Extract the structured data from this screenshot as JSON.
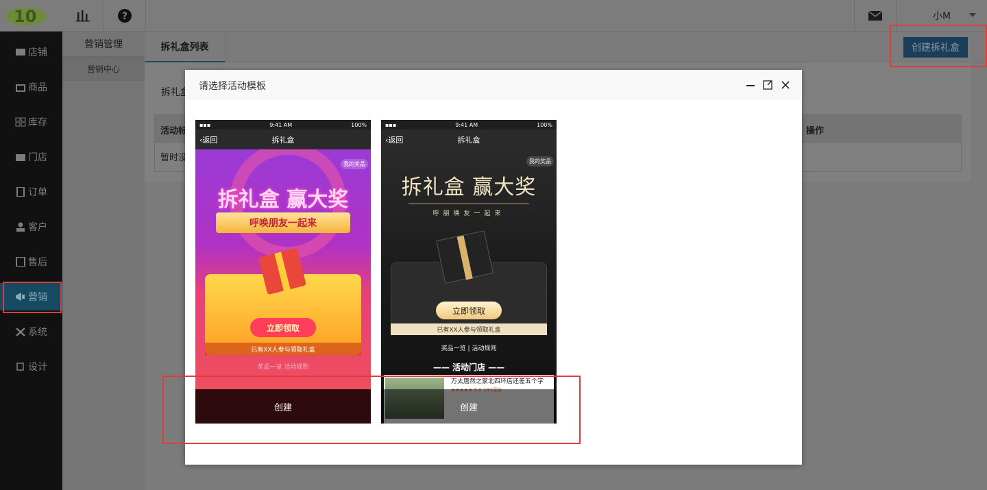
{
  "topbar": {
    "logo_text": "10",
    "user_name": "小M"
  },
  "sidebar": {
    "items": [
      {
        "label": "店铺",
        "icon": "store-icon"
      },
      {
        "label": "商品",
        "icon": "product-icon"
      },
      {
        "label": "库存",
        "icon": "inventory-icon"
      },
      {
        "label": "门店",
        "icon": "shop-icon"
      },
      {
        "label": "订单",
        "icon": "order-icon"
      },
      {
        "label": "客户",
        "icon": "customer-icon"
      },
      {
        "label": "售后",
        "icon": "aftersale-icon"
      },
      {
        "label": "营销",
        "icon": "megaphone-icon",
        "active": true
      },
      {
        "label": "系统",
        "icon": "tools-icon"
      },
      {
        "label": "设计",
        "icon": "design-icon"
      }
    ]
  },
  "subnav": {
    "title": "营销管理",
    "items": [
      "营销中心"
    ]
  },
  "main": {
    "tab": "拆礼盒列表",
    "create_button": "创建拆礼盒",
    "panel_label": "拆礼盒",
    "table": {
      "col1": "活动标",
      "col_ops": "操作",
      "empty_text": "暂时没"
    }
  },
  "modal": {
    "title": "请选择活动模板",
    "templates": [
      {
        "status_time": "9:41 AM",
        "status_battery": "100%",
        "back": "返回",
        "nav_title": "拆礼盒",
        "badge": "我的奖品",
        "headline": "拆礼盒 赢大奖",
        "ribbon": "呼唤朋友一起来",
        "button": "立即领取",
        "join_text": "已有XX人参与领取礼盒",
        "links": "奖品一览  活动规则",
        "create": "创建"
      },
      {
        "status_time": "9:41 AM",
        "status_battery": "100%",
        "back": "返回",
        "nav_title": "拆礼盒",
        "badge": "我的奖品",
        "headline": "拆礼盒 赢大奖",
        "subline": "呼朋唤友一起来",
        "button": "立即领取",
        "join_text": "已有XX人参与领取礼盒",
        "links": "奖品一览  |  活动规则",
        "store_heading": "—— 活动门店 ——",
        "store_name": "万太唐然之家北四环店还差五个字",
        "store_meta": "★★★★★ 5.0 193评价",
        "create": "创建"
      }
    ]
  },
  "colors": {
    "accent": "#2e6da4",
    "highlight": "#e23b3b"
  }
}
